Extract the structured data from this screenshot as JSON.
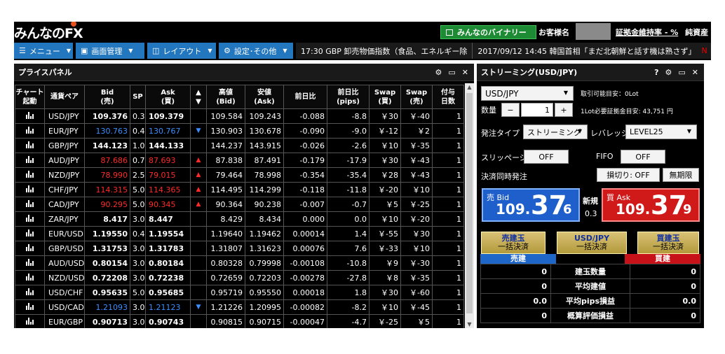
{
  "header": {
    "logo_text": "みんなのFX",
    "binary_label": "みんなのバイナリー",
    "customer_label": "お客様名",
    "margin_label": "証拠金維持率 - %",
    "margin_trail": "純資産"
  },
  "toolbar": {
    "menu_label": "メニュー",
    "screen_label": "画面管理",
    "layout_label": "レイアウト",
    "settings_label": "設定･その他",
    "news_1": "17:30 GBP 卸売物価指数（食品、エネルギー除",
    "news_2": "2017/09/12 14:45 韓国首相「まだ北朝鮮と話す機は熟さず」",
    "news_3": "N"
  },
  "price_panel": {
    "title": "プライスパネル",
    "columns": {
      "chart": [
        "チャート",
        "起動"
      ],
      "pair": "通貨ペア",
      "bid": [
        "Bid",
        "(売)"
      ],
      "sp": "SP",
      "ask": [
        "Ask",
        "(買)"
      ],
      "arrow": [
        "▲",
        "▼"
      ],
      "high": [
        "高値",
        "(Bid)"
      ],
      "low": [
        "安値",
        "(Ask)"
      ],
      "change": "前日比",
      "change_pips": [
        "前日比",
        "(pips)"
      ],
      "swap_sell": [
        "Swap",
        "(買)"
      ],
      "swap_buy": [
        "Swap",
        "(売)"
      ],
      "days": [
        "付与",
        "日数"
      ]
    },
    "rows": [
      {
        "pair": "USD/JPY",
        "bid": "109.376",
        "sp": "0.3",
        "ask": "109.379",
        "dir": "",
        "high": "109.584",
        "low": "109.243",
        "change": "-0.088",
        "pips": "-8.8",
        "swap_a": "￥30",
        "swap_b": "￥-40",
        "days": "1"
      },
      {
        "pair": "EUR/JPY",
        "bid": "130.763",
        "sp": "0.4",
        "ask": "130.767",
        "dir": "down",
        "high": "130.903",
        "low": "130.678",
        "change": "-0.090",
        "pips": "-9.0",
        "swap_a": "￥-12",
        "swap_b": "￥2",
        "days": "1"
      },
      {
        "pair": "GBP/JPY",
        "bid": "144.123",
        "sp": "1.0",
        "ask": "144.133",
        "dir": "",
        "high": "144.237",
        "low": "143.915",
        "change": "-0.026",
        "pips": "-2.6",
        "swap_a": "￥10",
        "swap_b": "￥-35",
        "days": "1"
      },
      {
        "pair": "AUD/JPY",
        "bid": "87.686",
        "sp": "0.7",
        "ask": "87.693",
        "dir": "up",
        "high": "87.838",
        "low": "87.491",
        "change": "-0.179",
        "pips": "-17.9",
        "swap_a": "￥30",
        "swap_b": "￥-43",
        "days": "1"
      },
      {
        "pair": "NZD/JPY",
        "bid": "78.990",
        "sp": "2.5",
        "ask": "79.015",
        "dir": "up",
        "high": "79.464",
        "low": "78.998",
        "change": "-0.354",
        "pips": "-35.4",
        "swap_a": "￥28",
        "swap_b": "￥-43",
        "days": "1"
      },
      {
        "pair": "CHF/JPY",
        "bid": "114.315",
        "sp": "5.0",
        "ask": "114.365",
        "dir": "up",
        "high": "114.495",
        "low": "114.299",
        "change": "-0.118",
        "pips": "-11.8",
        "swap_a": "￥-20",
        "swap_b": "￥10",
        "days": "1"
      },
      {
        "pair": "CAD/JPY",
        "bid": "90.295",
        "sp": "5.0",
        "ask": "90.345",
        "dir": "up",
        "high": "90.364",
        "low": "90.238",
        "change": "-0.007",
        "pips": "-0.7",
        "swap_a": "￥5",
        "swap_b": "￥-25",
        "days": "1"
      },
      {
        "pair": "ZAR/JPY",
        "bid": "8.417",
        "sp": "3.0",
        "ask": "8.447",
        "dir": "",
        "high": "8.429",
        "low": "8.434",
        "change": "0.000",
        "pips": "0.0",
        "swap_a": "￥10",
        "swap_b": "￥-20",
        "days": "1"
      },
      {
        "pair": "EUR/USD",
        "bid": "1.19550",
        "sp": "0.4",
        "ask": "1.19554",
        "dir": "",
        "high": "1.19640",
        "low": "1.19462",
        "change": "0.00014",
        "pips": "1.4",
        "swap_a": "￥-55",
        "swap_b": "￥30",
        "days": "1"
      },
      {
        "pair": "GBP/USD",
        "bid": "1.31753",
        "sp": "3.0",
        "ask": "1.31783",
        "dir": "",
        "high": "1.31807",
        "low": "1.31623",
        "change": "0.00076",
        "pips": "7.6",
        "swap_a": "￥-33",
        "swap_b": "￥10",
        "days": "1"
      },
      {
        "pair": "AUD/USD",
        "bid": "0.80154",
        "sp": "3.0",
        "ask": "0.80184",
        "dir": "",
        "high": "0.80328",
        "low": "0.79998",
        "change": "-0.00108",
        "pips": "-10.8",
        "swap_a": "￥9",
        "swap_b": "￥-30",
        "days": "1"
      },
      {
        "pair": "NZD/USD",
        "bid": "0.72208",
        "sp": "3.0",
        "ask": "0.72238",
        "dir": "",
        "high": "0.72659",
        "low": "0.72203",
        "change": "-0.00278",
        "pips": "-27.8",
        "swap_a": "￥8",
        "swap_b": "￥-35",
        "days": "1"
      },
      {
        "pair": "USD/CHF",
        "bid": "0.95635",
        "sp": "5.0",
        "ask": "0.95685",
        "dir": "",
        "high": "0.95719",
        "low": "0.95550",
        "change": "0.00018",
        "pips": "1.8",
        "swap_a": "￥30",
        "swap_b": "￥-60",
        "days": "1"
      },
      {
        "pair": "USD/CAD",
        "bid": "1.21093",
        "sp": "3.0",
        "ask": "1.21123",
        "dir": "down",
        "high": "1.21226",
        "low": "1.20995",
        "change": "-0.00082",
        "pips": "-8.2",
        "swap_a": "￥10",
        "swap_b": "￥-45",
        "days": "1"
      },
      {
        "pair": "EUR/GBP",
        "bid": "0.90713",
        "sp": "3.0",
        "ask": "0.90743",
        "dir": "",
        "high": "0.90815",
        "low": "0.90715",
        "change": "-0.00047",
        "pips": "-4.7",
        "swap_a": "￥-25",
        "swap_b": "￥5",
        "days": "1"
      }
    ]
  },
  "stream_panel": {
    "title": "ストリーミング(USD/JPY)",
    "pair_select": "USD/JPY",
    "tradable_amount": "取引可能目安：0Lot",
    "qty_label": "数量",
    "qty_value": "1",
    "margin_per_lot": "1Lot必要証拠金目安: 43,751 円",
    "order_type_label": "発注タイプ",
    "order_type_value": "ストリーミング",
    "leverage_label": "レバレッジ",
    "leverage_value": "LEVEL25",
    "slippage_label": "スリッページ",
    "slippage_value": "OFF",
    "fifo_label": "FIFO",
    "fifo_value": "OFF",
    "settle_label": "決済同時発注",
    "stoploss_value": "損切り: OFF",
    "unlimited_value": "無期限",
    "bid_label": "売 Bid",
    "bid_main": "109.",
    "bid_big": "37",
    "bid_small": "6",
    "new_label": "新規",
    "spread_value": "0.3",
    "ask_label": "買 Ask",
    "ask_main": "109.",
    "ask_big": "37",
    "ask_small": "9",
    "sell_close": [
      "売建玉",
      "一括決済"
    ],
    "pair_close": [
      "USD/JPY",
      "一括決済"
    ],
    "buy_close": [
      "買建玉",
      "一括決済"
    ],
    "sell_header": "売建",
    "buy_header": "買建",
    "positions": [
      {
        "sell": "0",
        "label": "建玉数量",
        "buy": "0"
      },
      {
        "sell": "0",
        "label": "平均建値",
        "buy": "0"
      },
      {
        "sell": "0.0",
        "label": "平均pips損益",
        "buy": "0.0"
      },
      {
        "sell": "0",
        "label": "概算評価損益",
        "buy": "0"
      }
    ]
  },
  "colors": {
    "accent_blue": "#2377bf",
    "price_up": "#3b8fff",
    "price_down": "#ff2a2a",
    "bid_box": "#1f5fcc",
    "ask_box": "#d01a1a"
  }
}
